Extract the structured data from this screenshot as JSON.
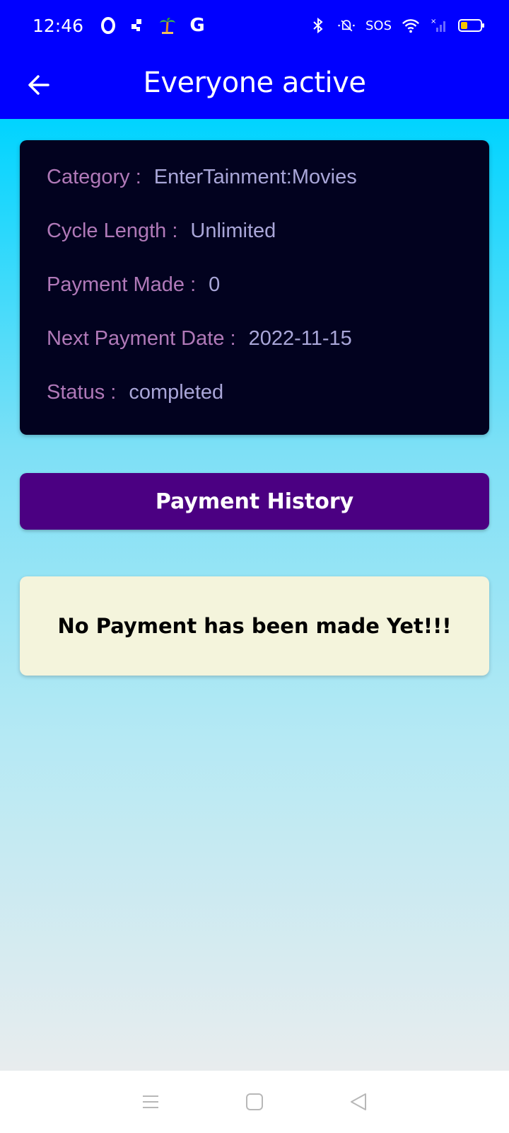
{
  "status_bar": {
    "time": "12:46",
    "sos_label": "SOS",
    "left_icons": [
      "opera-icon",
      "notification-dots-icon",
      "palm-tree-icon",
      "google-icon"
    ],
    "right_icons": [
      "bluetooth-icon",
      "mute-icon",
      "wifi-icon",
      "cellular-signal-icon",
      "battery-icon"
    ]
  },
  "app_bar": {
    "title": "Everyone active",
    "back_icon": "arrow-left-icon"
  },
  "details": [
    {
      "label": "Category :",
      "value": "EnterTainment:Movies"
    },
    {
      "label": "Cycle Length :",
      "value": "Unlimited"
    },
    {
      "label": "Payment Made :",
      "value": "0"
    },
    {
      "label": "Next Payment Date :",
      "value": "2022-11-15"
    },
    {
      "label": "Status :",
      "value": "completed"
    }
  ],
  "payment_history_button": "Payment History",
  "empty_message": "No Payment has been made Yet!!!",
  "colors": {
    "primary": "#0000ff",
    "card_bg": "#02021f",
    "label": "#b079b8",
    "value": "#a9a6d8",
    "button": "#4b0082",
    "empty_bg": "#f4f4dc"
  }
}
